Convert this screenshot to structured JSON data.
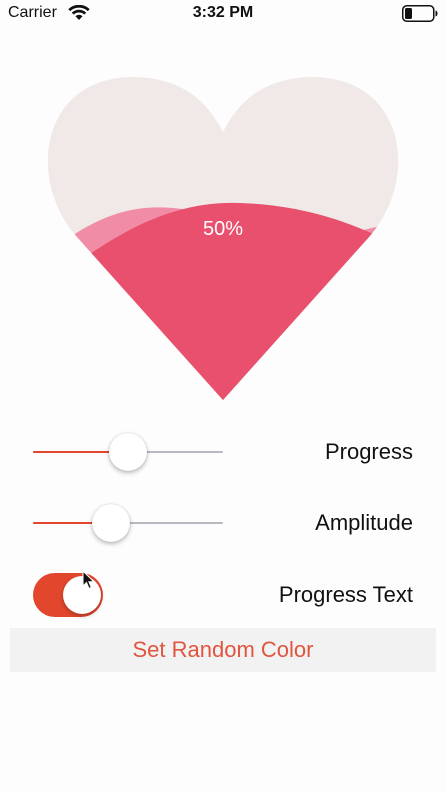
{
  "status_bar": {
    "carrier": "Carrier",
    "time": "3:32 PM",
    "wifi_icon": "wifi-icon",
    "battery_icon": "battery-icon"
  },
  "heart_view": {
    "progress": 0.5,
    "progress_text": "50%",
    "colors": {
      "background": "#f1e8e8",
      "wave_back": "#f08ca6",
      "wave_front": "#e8506e",
      "text": "#ffffff"
    }
  },
  "controls": {
    "progress": {
      "label": "Progress",
      "value": 0.5
    },
    "amplitude": {
      "label": "Amplitude",
      "value": 0.41
    },
    "progress_text": {
      "label": "Progress Text",
      "on": true
    },
    "random_color_button": {
      "label": "Set Random Color"
    }
  },
  "accent_color": "#e2472e"
}
